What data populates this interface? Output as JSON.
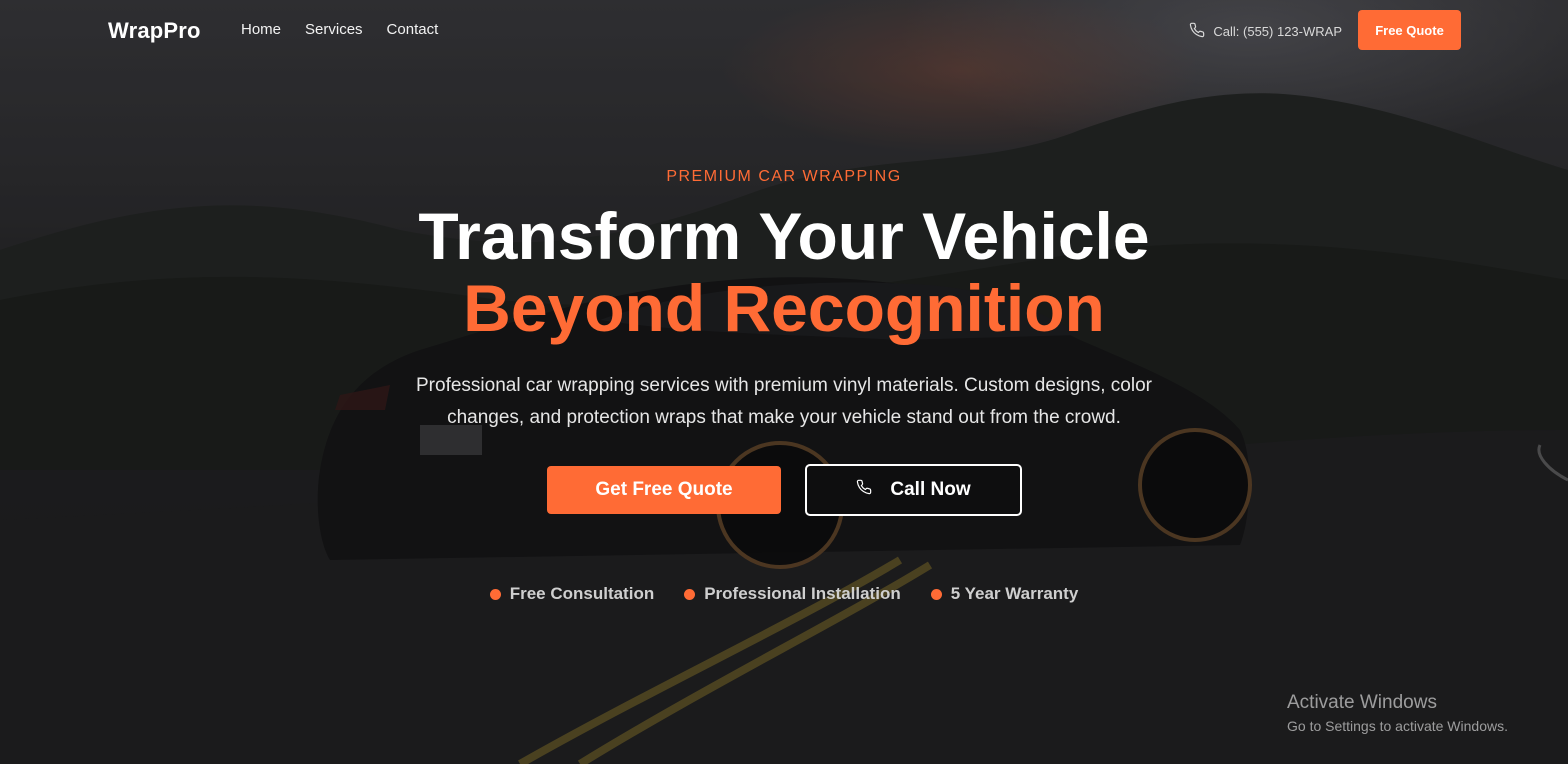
{
  "brand": {
    "name": "WrapPro",
    "accent_color": "#ff6b35"
  },
  "nav": {
    "links": [
      {
        "label": "Home"
      },
      {
        "label": "Services"
      },
      {
        "label": "Contact"
      }
    ],
    "phone": {
      "icon": "phone-icon",
      "label": "Call: (555) 123-WRAP"
    },
    "quote_button": "Free Quote"
  },
  "hero": {
    "eyebrow": "PREMIUM CAR WRAPPING",
    "title_line1": "Transform Your Vehicle",
    "title_line2": "Beyond Recognition",
    "subtitle": "Professional car wrapping services with premium vinyl materials. Custom designs, color changes, and protection wraps that make your vehicle stand out from the crowd.",
    "primary_button": "Get Free Quote",
    "secondary_button": {
      "icon": "phone-icon",
      "label": "Call Now"
    },
    "features": [
      {
        "label": "Free Consultation"
      },
      {
        "label": "Professional Installation"
      },
      {
        "label": "5 Year Warranty"
      }
    ]
  },
  "watermark": {
    "title": "Activate Windows",
    "subtitle": "Go to Settings to activate Windows."
  }
}
